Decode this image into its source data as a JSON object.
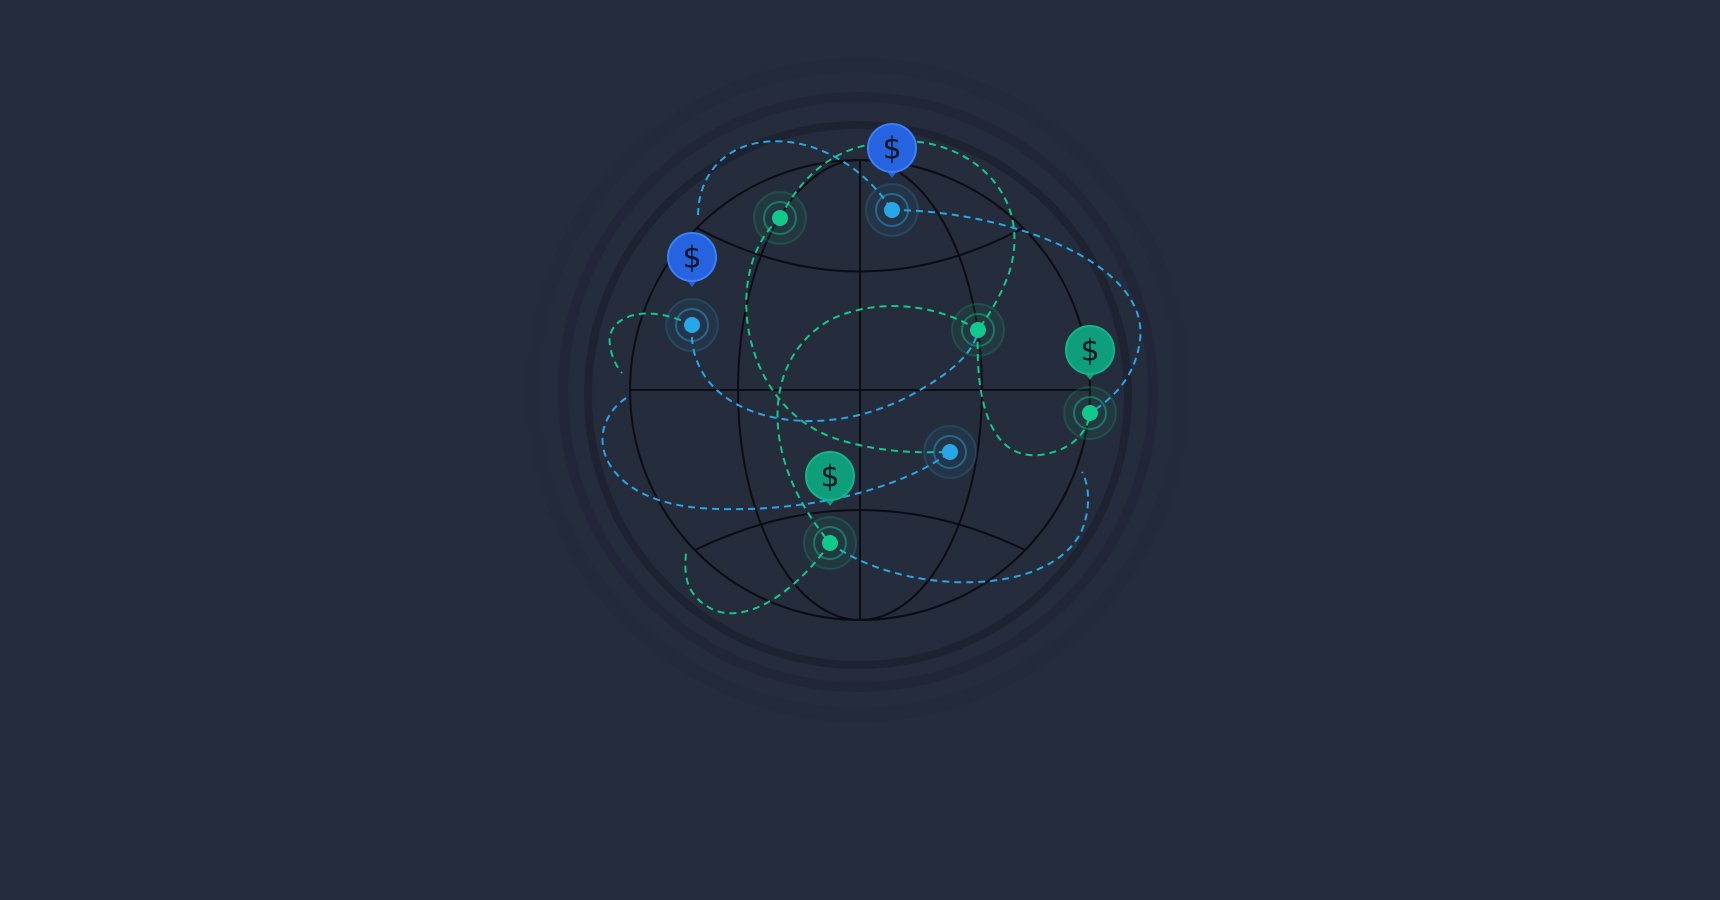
{
  "colors": {
    "background": "#252c3b",
    "globe_lines": "#0a0d13",
    "blue_accent": "#27a7e8",
    "green_accent": "#10c98a",
    "blue_pin": "#2563e0",
    "green_pin": "#0f9e7c"
  },
  "pins": [
    {
      "color": "blue",
      "label": "$"
    },
    {
      "color": "blue",
      "label": "$"
    },
    {
      "color": "green",
      "label": "$"
    },
    {
      "color": "green",
      "label": "$"
    }
  ],
  "nodes": [
    {
      "color": "green"
    },
    {
      "color": "blue"
    },
    {
      "color": "blue"
    },
    {
      "color": "green"
    },
    {
      "color": "green"
    },
    {
      "color": "blue"
    },
    {
      "color": "green"
    }
  ]
}
